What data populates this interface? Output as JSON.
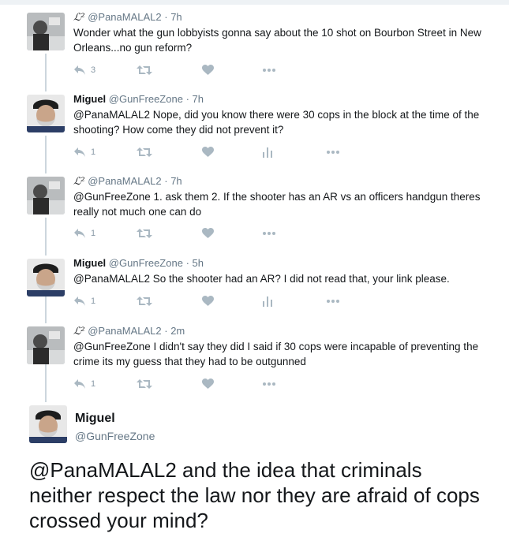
{
  "tweets": [
    {
      "kind": "panamalal",
      "name_symbol": "ℒ²",
      "handle": "@PanaMALAL2",
      "time": "· 7h",
      "text": "Wonder what the gun lobbyists gonna say about the 10 shot on Bourbon Street in New Orleans...no gun reform?",
      "reply_count": "3",
      "has_analytics": false
    },
    {
      "kind": "miguel",
      "name": "Miguel",
      "handle": "@GunFreeZone",
      "time": "· 7h",
      "text": "@PanaMALAL2 Nope, did you know there were 30 cops in the block at the time of the shooting? How come they did not prevent it?",
      "reply_count": "1",
      "has_analytics": true
    },
    {
      "kind": "panamalal",
      "name_symbol": "ℒ²",
      "handle": "@PanaMALAL2",
      "time": "· 7h",
      "text": "@GunFreeZone 1. ask them 2. If the shooter has an AR vs an officers handgun theres really not much one can do",
      "reply_count": "1",
      "has_analytics": false
    },
    {
      "kind": "miguel",
      "name": "Miguel",
      "handle": "@GunFreeZone",
      "time": "· 5h",
      "text": "@PanaMALAL2 So the shooter had an AR? I did not read that, your link please.",
      "reply_count": "1",
      "has_analytics": true
    },
    {
      "kind": "panamalal",
      "name_symbol": "ℒ²",
      "handle": "@PanaMALAL2",
      "time": "· 2m",
      "text": "@GunFreeZone I didn't say they did I said if 30 cops were incapable of preventing the crime its my guess that they had to be outgunned",
      "reply_count": "1",
      "has_analytics": false
    }
  ],
  "main_tweet": {
    "name": "Miguel",
    "handle": "@GunFreeZone",
    "text": "@PanaMALAL2 and the idea that criminals neither respect the law nor they are afraid of cops crossed your mind?"
  },
  "icons": {
    "reply": "reply-icon",
    "retweet": "retweet-icon",
    "like": "heart-icon",
    "analytics": "analytics-icon",
    "more": "more-icon"
  },
  "colors": {
    "icon_gray": "#aab8c2",
    "meta_gray": "#657786",
    "thread_line": "#ccd6dd"
  }
}
